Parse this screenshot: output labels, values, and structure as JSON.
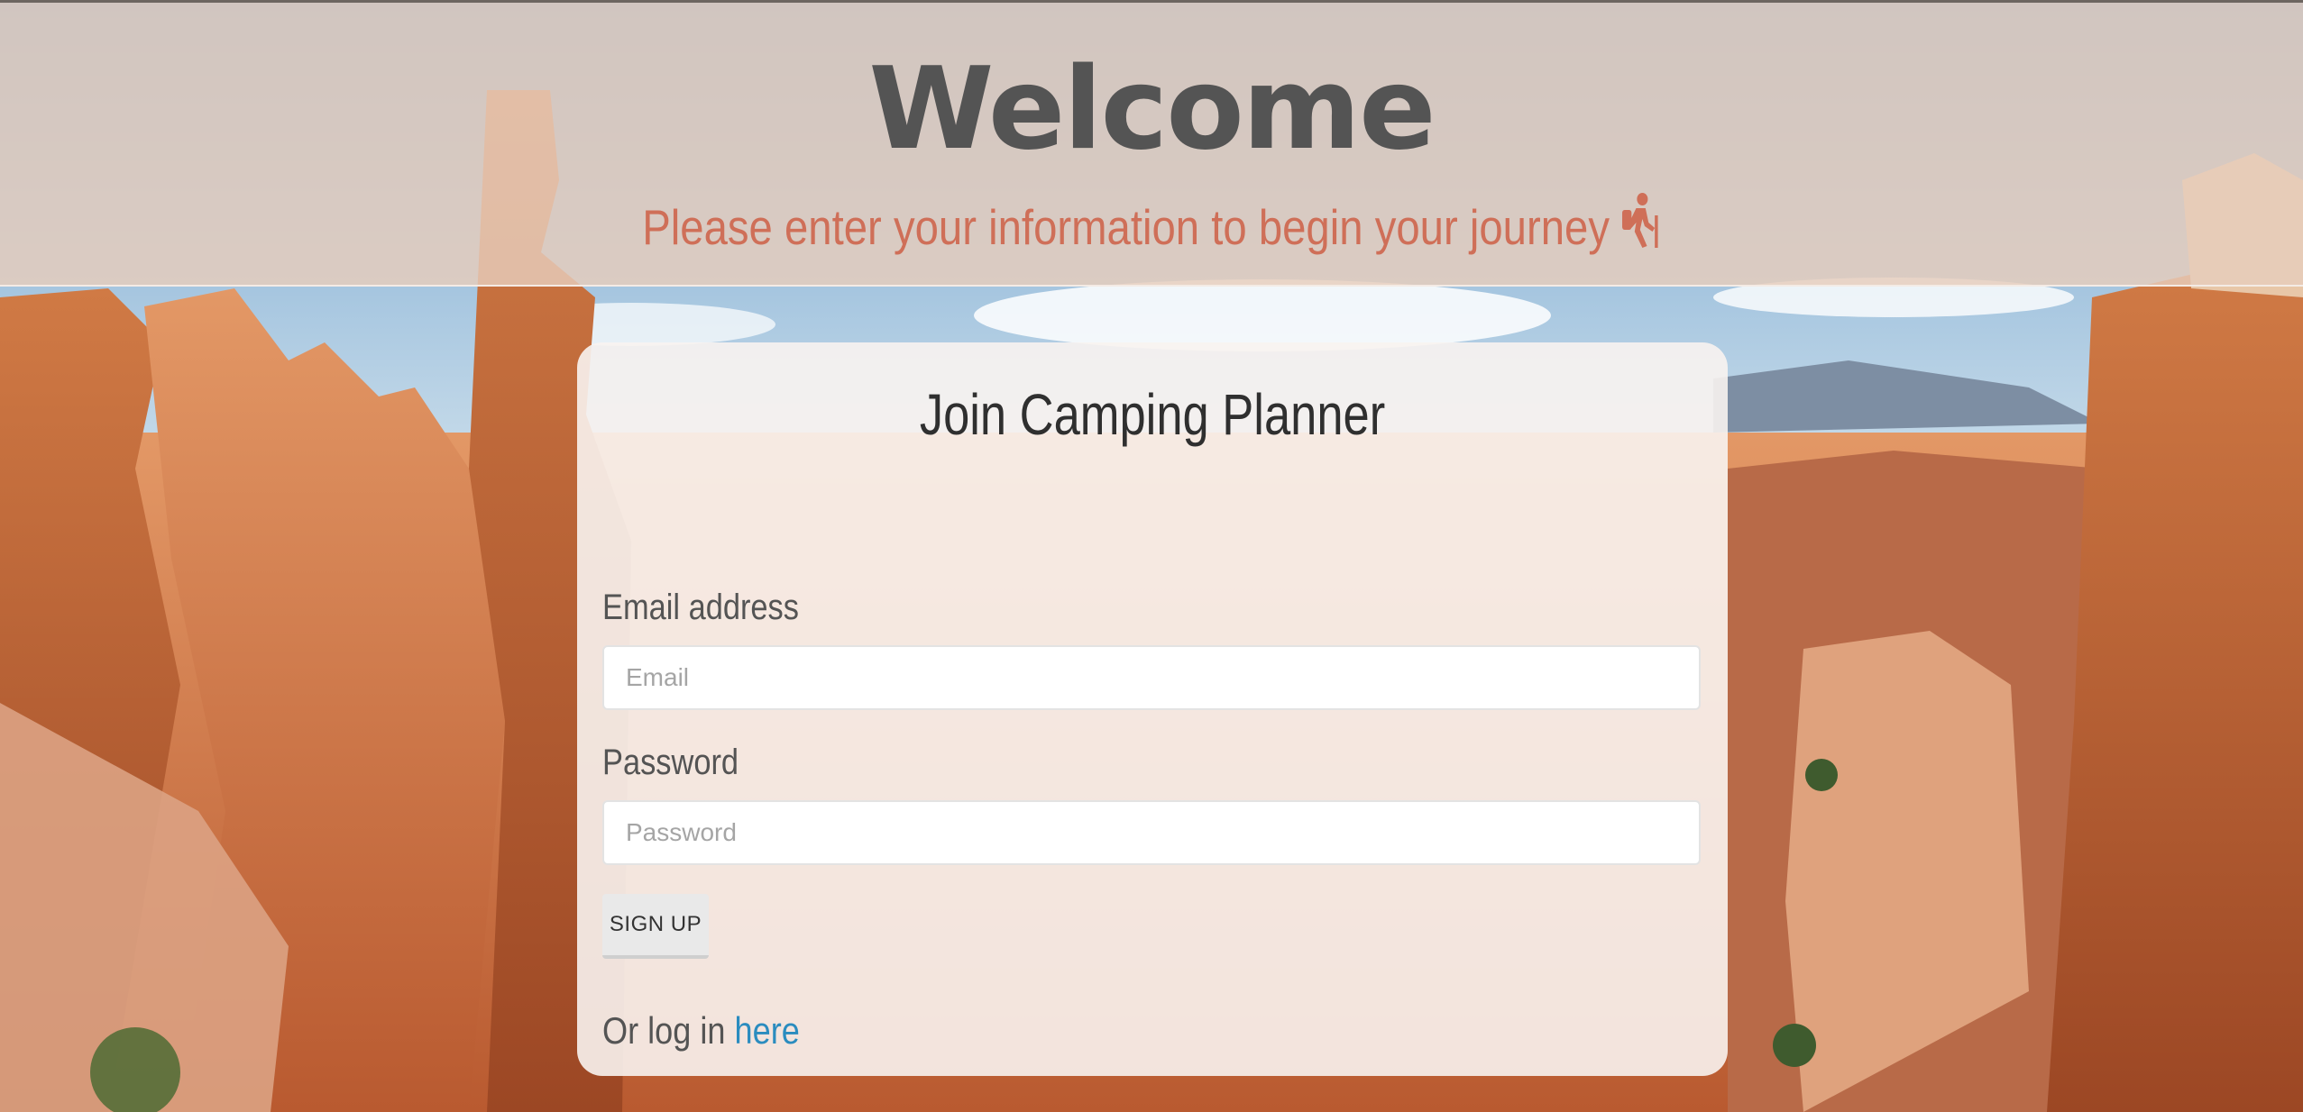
{
  "hero": {
    "title": "Welcome",
    "subtitle": "Please enter your information to begin your journey",
    "icon": "hiking-icon"
  },
  "form": {
    "title": "Join Camping Planner",
    "email_label": "Email address",
    "email_placeholder": "Email",
    "email_value": "",
    "password_label": "Password",
    "password_placeholder": "Password",
    "password_value": "",
    "signup_label": "SIGN UP",
    "login_prefix": "Or log in ",
    "login_link": "here"
  },
  "colors": {
    "title": "#545454",
    "subtitle": "#cf6f58",
    "link": "#2a8cbf"
  }
}
